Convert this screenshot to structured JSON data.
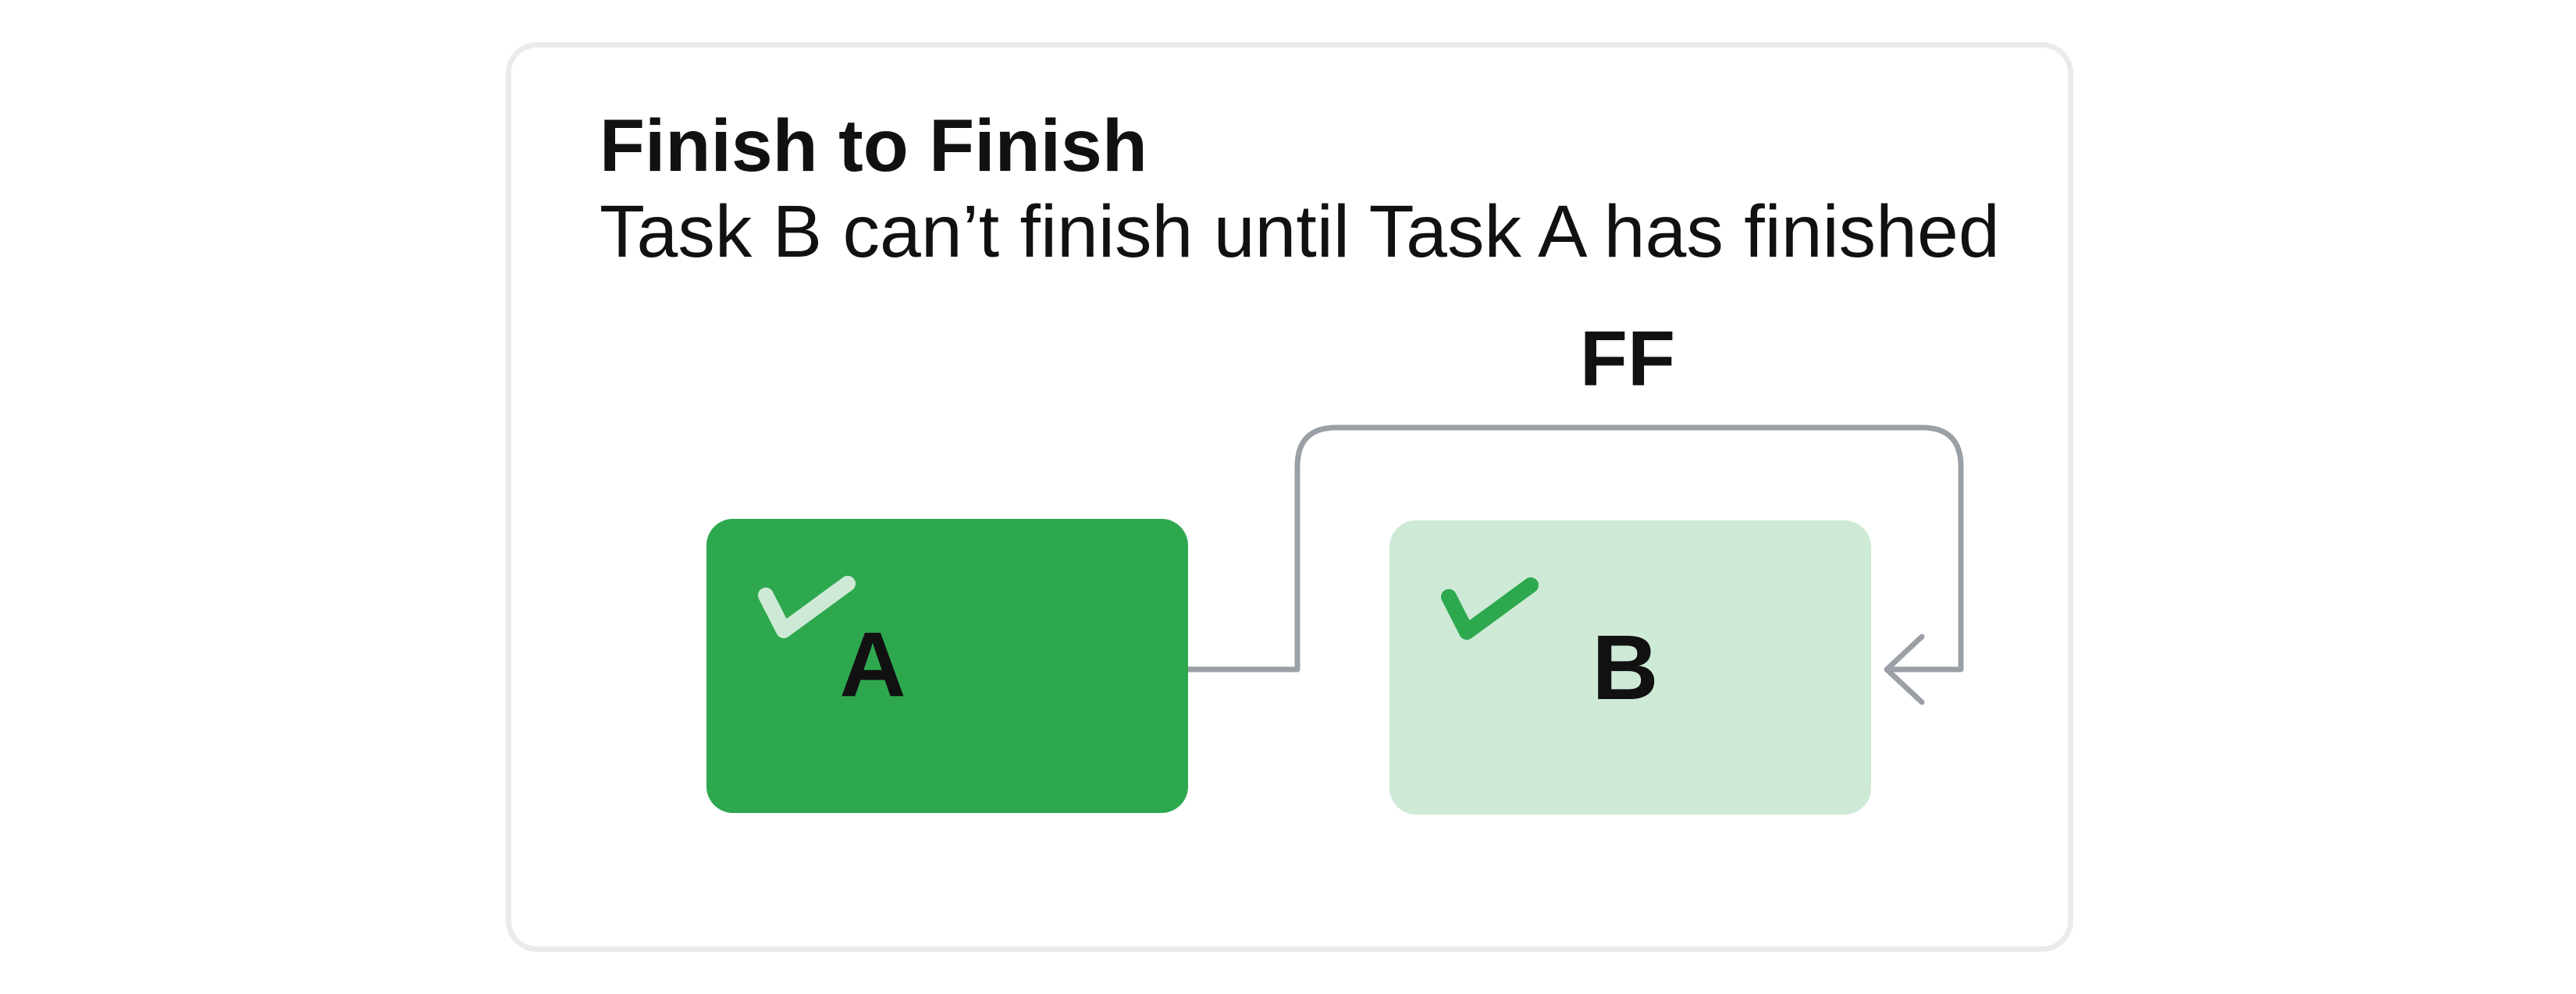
{
  "diagram": {
    "title": "Finish to Finish",
    "subtitle": "Task B can’t finish until Task A has finished",
    "link_type": "FF",
    "task_a": {
      "label": "A",
      "color": "#2ea84f",
      "check_color": "#ceead6"
    },
    "task_b": {
      "label": "B",
      "color": "#ceead6",
      "check_color": "#2ea84f"
    },
    "connector_color": "#9aa0a6",
    "border_color": "#ebebeb"
  }
}
